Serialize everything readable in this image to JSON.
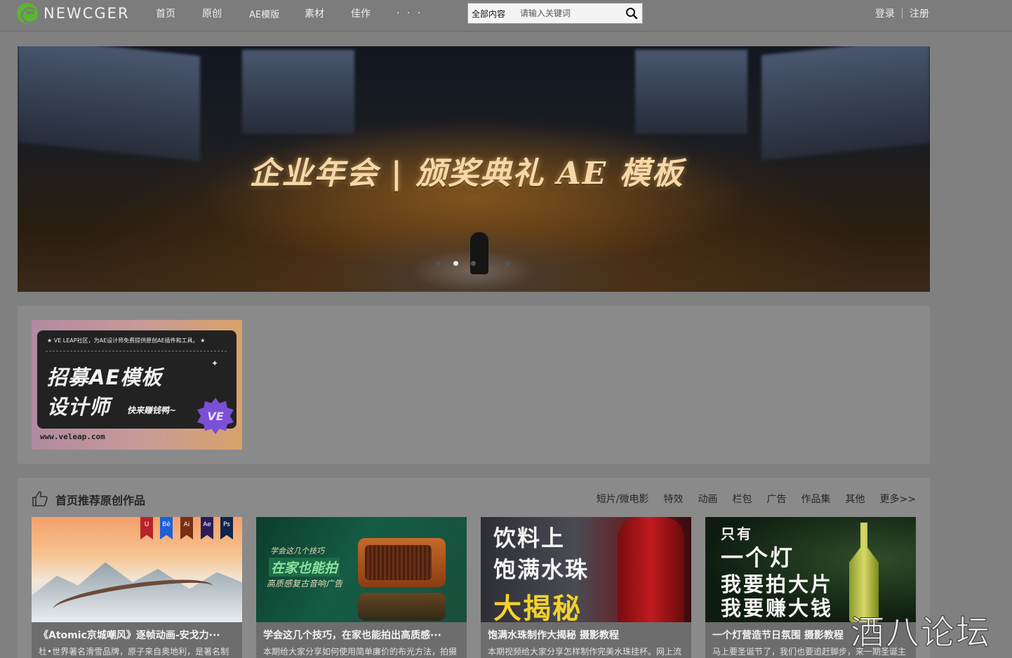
{
  "header": {
    "logo_text": "NEWCGER",
    "nav": [
      "首页",
      "原创",
      "AE模版",
      "素材",
      "佳作",
      "· · ·"
    ],
    "search": {
      "category": "全部内容",
      "placeholder": "请输入关键词"
    },
    "auth": {
      "login": "登录",
      "register": "注册"
    }
  },
  "banner": {
    "title": "企业年会 | 颁奖典礼 AE 模板",
    "slides": 5,
    "active_slide": 2
  },
  "ad": {
    "top_text": "★  VE LEAP社区，为AE设计师免费提供原创AE插件和工具。 ★",
    "line1": "招募AE模板",
    "line2": "设计师",
    "line3": "快来赚钱鸭~",
    "badge": "VE",
    "url": "www.veleap.com"
  },
  "recommend": {
    "title": "首页推荐原创作品",
    "tabs": [
      "短片/微电影",
      "特效",
      "动画",
      "栏包",
      "广告",
      "作品集",
      "其他",
      "更多>>"
    ],
    "cards": [
      {
        "title": "《Atomic京城嘲风》逐帧动画-安戈力···",
        "desc": "杜•世界著名滑雪品牌，原子来自奥地利，是著名制",
        "ribbons": [
          "U",
          "Bē",
          "Ai",
          "Ae",
          "Ps"
        ]
      },
      {
        "title": "学会这几个技巧，在家也能拍出高质感···",
        "desc": "本期给大家分享如何使用简单廉价的布光方法，拍摄",
        "thumb_lines": [
          "学会这几个技巧",
          "在家也能拍",
          "高质感复古音响广告"
        ]
      },
      {
        "title": "饱满水珠制作大揭秘  摄影教程",
        "desc": "本期视频给大家分享怎样制作完美水珠挂杯。网上流",
        "thumb_lines": [
          "饮料上",
          "饱满水珠",
          "大揭秘"
        ]
      },
      {
        "title": "一个灯营造节日氛围  摄影教程",
        "desc": "马上要圣诞节了，我们也要追赶脚步，来一期圣诞主",
        "thumb_lines": [
          "只有",
          "一个灯",
          "我要拍大片",
          "我要赚大钱"
        ]
      }
    ]
  },
  "watermark": "酒八论坛"
}
